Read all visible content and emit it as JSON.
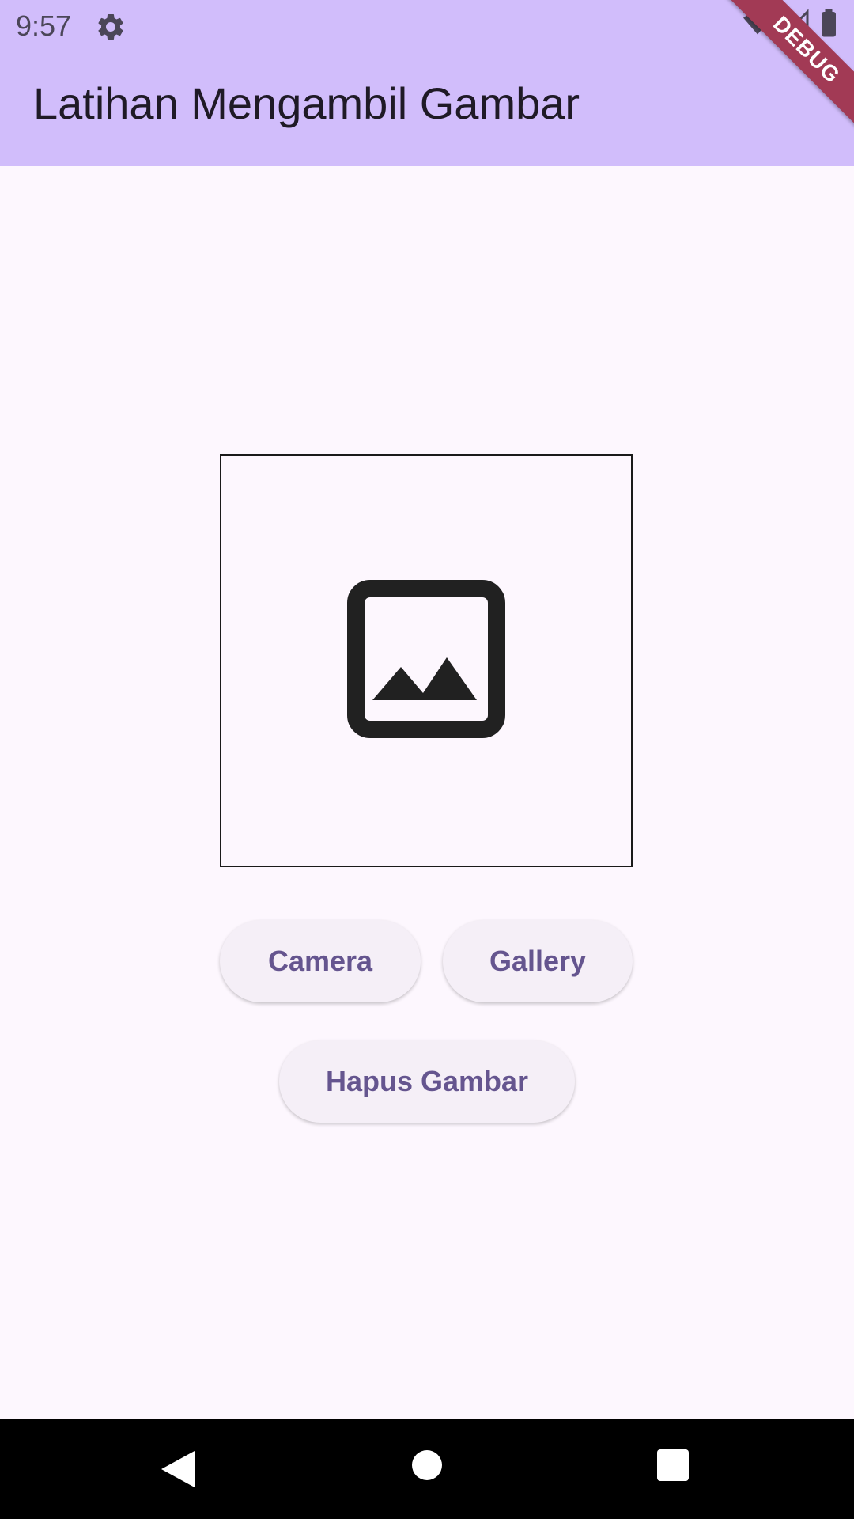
{
  "status_bar": {
    "time": "9:57",
    "icons": [
      "gear-icon",
      "wifi-icon",
      "signal-icon",
      "battery-icon"
    ]
  },
  "debug_banner": "DEBUG",
  "app_bar": {
    "title": "Latihan Mengambil Gambar",
    "background": "#d1bdfb"
  },
  "image_preview": {
    "placeholder_icon": "image-icon"
  },
  "buttons": {
    "camera": "Camera",
    "gallery": "Gallery",
    "delete": "Hapus Gambar"
  },
  "nav_bar": {
    "icons": [
      "back-icon",
      "home-icon",
      "recents-icon"
    ]
  },
  "colors": {
    "accent": "#65558f",
    "page_bg": "#fdf7fe",
    "button_bg": "#f5eff7"
  }
}
